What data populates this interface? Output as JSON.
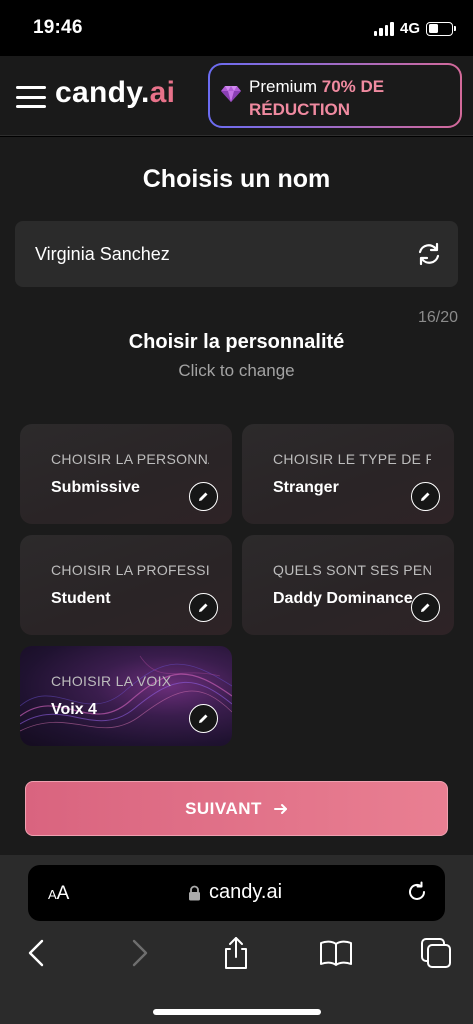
{
  "status_bar": {
    "time": "19:46",
    "network": "4G"
  },
  "header": {
    "logo_main": "candy.",
    "logo_accent": "ai",
    "premium_word": "Premium",
    "premium_deal_1": "70% DE",
    "premium_deal_2": "RÉDUCTION"
  },
  "name_section": {
    "title": "Choisis un nom",
    "name_value": "Virginia Sanchez",
    "char_count": "16/20"
  },
  "personality_section": {
    "title": "Choisir la personnalité",
    "subtitle": "Click to change"
  },
  "cards": [
    {
      "label": "CHOISIR LA PERSONNALITÉ",
      "value": "Submissive"
    },
    {
      "label": "CHOISIR LE TYPE DE RELATION",
      "value": "Stranger"
    },
    {
      "label": "CHOISIR LA PROFESSION",
      "value": "Student"
    },
    {
      "label": "QUELS SONT SES PENCHANTS",
      "value": "Daddy Dominance"
    },
    {
      "label": "CHOISIR LA VOIX",
      "value": "Voix 4"
    }
  ],
  "next_button": {
    "label": "SUIVANT"
  },
  "browser": {
    "aa_label_small": "A",
    "aa_label_big": "A",
    "url": "candy.ai"
  },
  "colors": {
    "accent": "#e8728a",
    "button": "#e06c84",
    "premium_border_start": "#6b6cf2",
    "premium_border_end": "#d46a9a"
  }
}
